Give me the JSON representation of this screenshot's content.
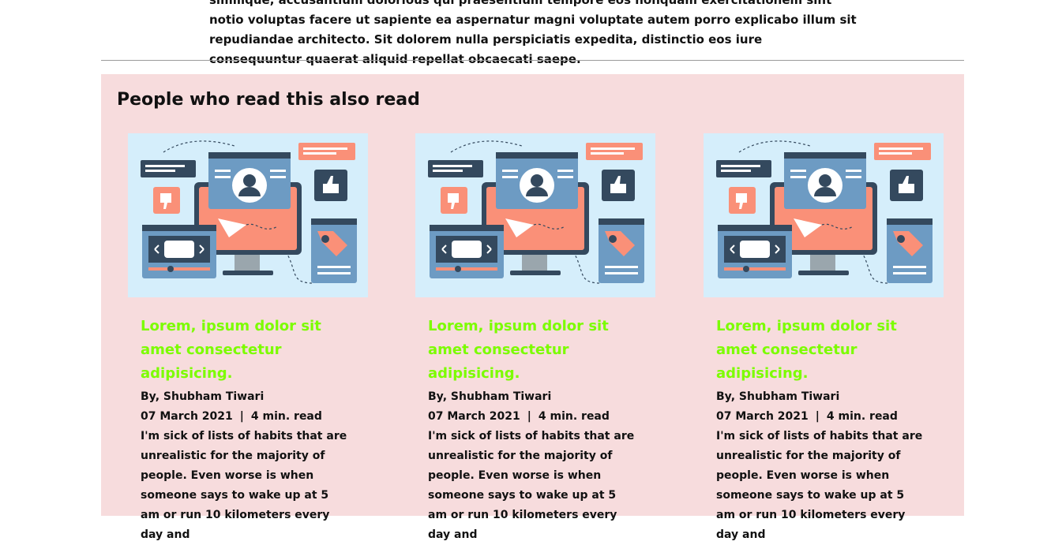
{
  "article": {
    "tail_text": "similique, accusantium dolorious qui praesentium tempore eos nonquam exercitationem sint notio voluptas facere ut sapiente ea aspernatur magni voluptate autem porro explicabo illum sit repudiandae architecto. Sit dolorem nulla perspiciatis expedita, distinctio eos iure consequuntur quaerat aliquid repellat obcaecati saepe."
  },
  "related": {
    "heading": "People who read this also read",
    "cards": [
      {
        "title": "Lorem, ipsum dolor sit amet consectetur adipisicing.",
        "author": "By, Shubham Tiwari",
        "date": "07 March 2021",
        "separator": "|",
        "read_time": "4 min. read",
        "excerpt": "I'm sick of lists of habits that are unrealistic for the majority of people. Even worse is when someone says to wake up at 5 am or run 10 kilometers every day and"
      },
      {
        "title": "Lorem, ipsum dolor sit amet consectetur adipisicing.",
        "author": "By, Shubham Tiwari",
        "date": "07 March 2021",
        "separator": "|",
        "read_time": "4 min. read",
        "excerpt": "I'm sick of lists of habits that are unrealistic for the majority of people. Even worse is when someone says to wake up at 5 am or run 10 kilometers every day and"
      },
      {
        "title": "Lorem, ipsum dolor sit amet consectetur adipisicing.",
        "author": "By, Shubham Tiwari",
        "date": "07 March 2021",
        "separator": "|",
        "read_time": "4 min. read",
        "excerpt": "I'm sick of lists of habits that are unrealistic for the majority of people. Even worse is when someone says to wake up at 5 am or run 10 kilometers every day and"
      }
    ]
  },
  "colors": {
    "section_bg": "#f7dcdd",
    "card_title": "#7cfc00",
    "illustration_bg": "#d5eefb",
    "illustration_accent": "#fa9078",
    "illustration_dark": "#34495e"
  },
  "icons": [
    "user-profile-icon",
    "thumbs-up-icon",
    "thumbs-down-icon",
    "paper-plane-icon",
    "price-tag-icon",
    "video-player-icon"
  ]
}
